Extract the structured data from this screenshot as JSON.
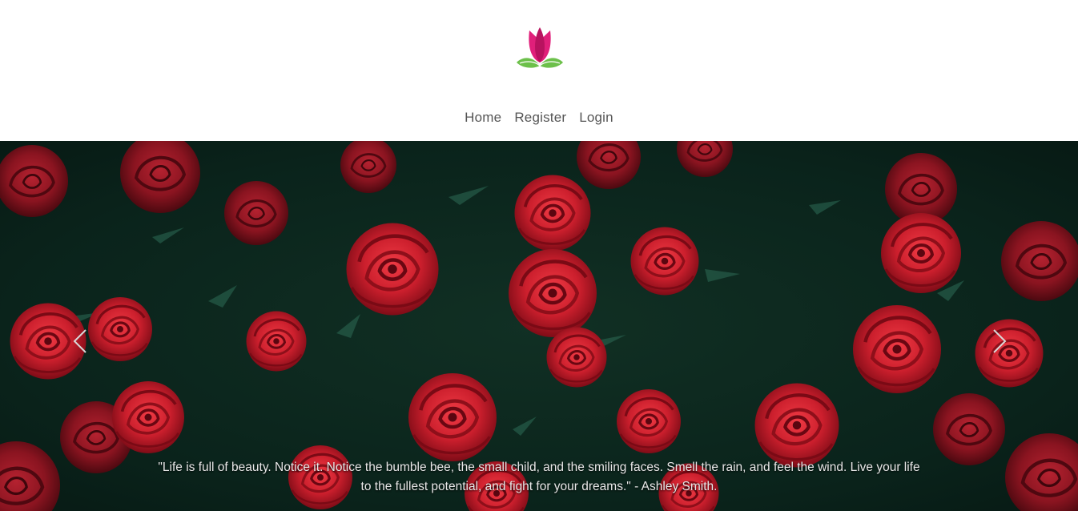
{
  "header": {
    "logo_icon": "lotus-flower-logo",
    "brand_colors": {
      "petal": "#e01f7a",
      "petal_dark": "#b8125f",
      "leaf": "#6cc04a"
    }
  },
  "nav": {
    "items": [
      {
        "label": "Home"
      },
      {
        "label": "Register"
      },
      {
        "label": "Login"
      }
    ]
  },
  "carousel": {
    "prev_icon": "chevron-left-icon",
    "next_icon": "chevron-right-icon",
    "caption": "\"Life is full of beauty. Notice it. Notice the bumble bee, the small child, and the smiling faces. Smell the rain, and feel the wind. Live your life to the fullest potential, and fight for your dreams.\" - Ashley Smith.",
    "image_subject": "red-roses-background",
    "colors": {
      "rose": "#c81e2c",
      "rose_dark": "#8e0f1a",
      "foliage": "#0c2a20"
    }
  }
}
